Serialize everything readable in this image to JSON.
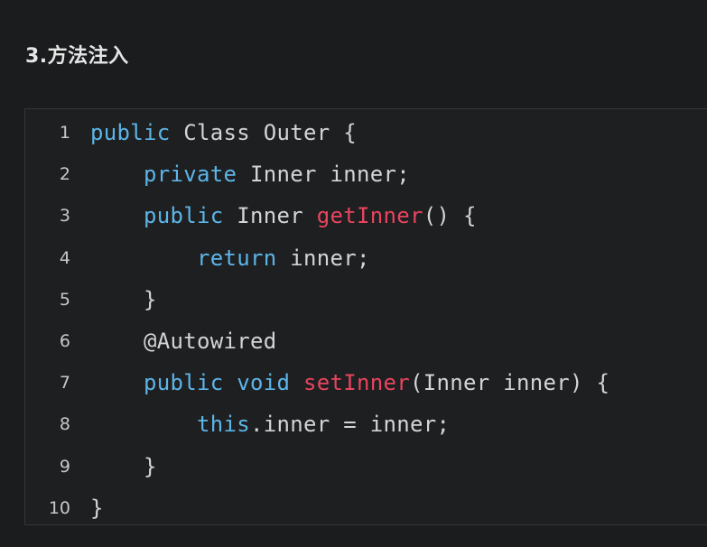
{
  "section": {
    "title": "3.方法注入"
  },
  "theme": {
    "background": "#1b1c1e",
    "keyword_color": "#5cb5e8",
    "function_color": "#e8445e",
    "text_color": "#d4d4d4"
  },
  "code": {
    "lines": [
      {
        "num": "1",
        "indent": "",
        "tokens": [
          [
            "kw",
            "public"
          ],
          [
            "id",
            " Class Outer {"
          ]
        ]
      },
      {
        "num": "2",
        "indent": "    ",
        "tokens": [
          [
            "kw",
            "private"
          ],
          [
            "id",
            " Inner inner;"
          ]
        ]
      },
      {
        "num": "3",
        "indent": "    ",
        "tokens": [
          [
            "kw",
            "public"
          ],
          [
            "id",
            " Inner "
          ],
          [
            "fn",
            "getInner"
          ],
          [
            "id",
            "() {"
          ]
        ]
      },
      {
        "num": "4",
        "indent": "        ",
        "tokens": [
          [
            "kw",
            "return"
          ],
          [
            "id",
            " inner;"
          ]
        ]
      },
      {
        "num": "5",
        "indent": "    ",
        "tokens": [
          [
            "id",
            "}"
          ]
        ]
      },
      {
        "num": "6",
        "indent": "    ",
        "tokens": [
          [
            "id",
            "@Autowired"
          ]
        ]
      },
      {
        "num": "7",
        "indent": "    ",
        "tokens": [
          [
            "kw",
            "public void"
          ],
          [
            "id",
            " "
          ],
          [
            "fn",
            "setInner"
          ],
          [
            "id",
            "(Inner inner) {"
          ]
        ]
      },
      {
        "num": "8",
        "indent": "        ",
        "tokens": [
          [
            "kw",
            "this"
          ],
          [
            "id",
            ".inner = inner;"
          ]
        ]
      },
      {
        "num": "9",
        "indent": "    ",
        "tokens": [
          [
            "id",
            "}"
          ]
        ]
      },
      {
        "num": "10",
        "indent": "",
        "tokens": [
          [
            "id",
            "}"
          ]
        ]
      }
    ]
  }
}
